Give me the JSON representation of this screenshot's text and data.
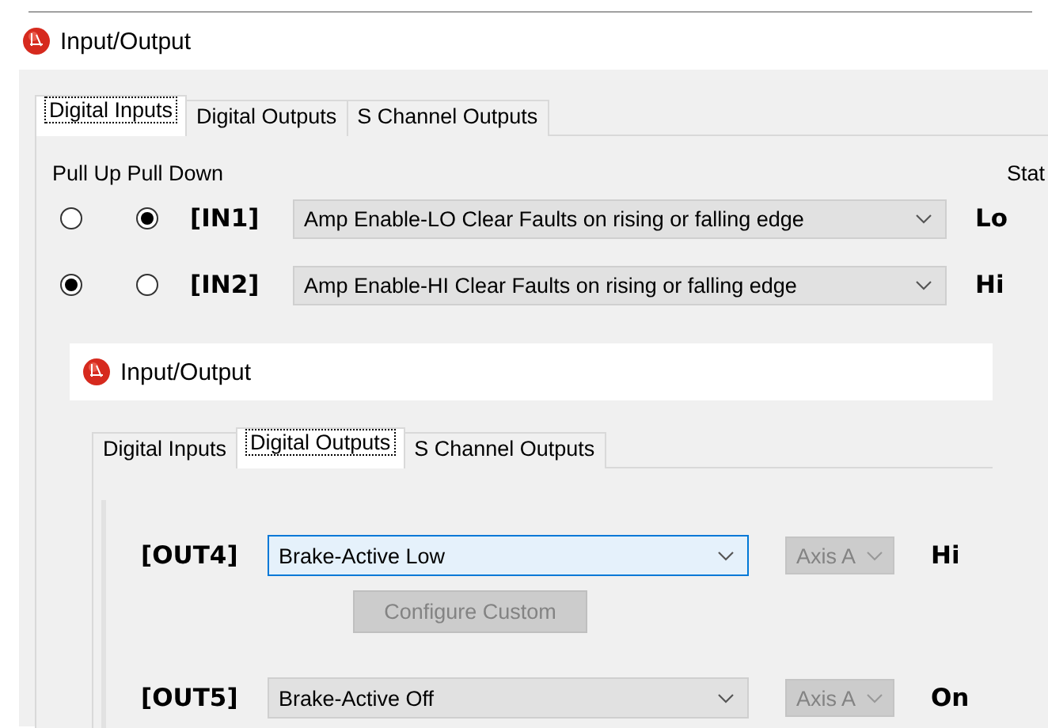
{
  "window": {
    "title": "Input/Output"
  },
  "tabs": [
    {
      "label": "Digital Inputs",
      "selected": true
    },
    {
      "label": "Digital Outputs",
      "selected": false
    },
    {
      "label": "S Channel Outputs",
      "selected": false
    }
  ],
  "pull_header": "Pull Up Pull Down",
  "state_header": "Stat",
  "inputs": [
    {
      "pull": [
        {
          "selected": false
        },
        {
          "selected": true
        }
      ],
      "label": "[IN1]",
      "function": "Amp Enable-LO Clear Faults on rising or falling edge",
      "state": "Lo"
    },
    {
      "pull": [
        {
          "selected": true
        },
        {
          "selected": false
        }
      ],
      "label": "[IN2]",
      "function": "Amp Enable-HI Clear Faults on rising or falling edge",
      "state": "Hi"
    }
  ],
  "inner_window": {
    "title": "Input/Output",
    "tabs": [
      {
        "label": "Digital Inputs",
        "selected": false
      },
      {
        "label": "Digital Outputs",
        "selected": true
      },
      {
        "label": "S Channel Outputs",
        "selected": false
      }
    ],
    "outputs": [
      {
        "label": "[OUT4]",
        "function": "Brake-Active Low",
        "focused": true,
        "axis": "Axis A",
        "axis_disabled": true,
        "state": "Hi",
        "configure_button": {
          "label": "Configure Custom",
          "disabled": true
        }
      },
      {
        "label": "[OUT5]",
        "function": "Brake-Active Off",
        "focused": false,
        "axis": "Axis A",
        "axis_disabled": true,
        "state": "On"
      }
    ]
  }
}
